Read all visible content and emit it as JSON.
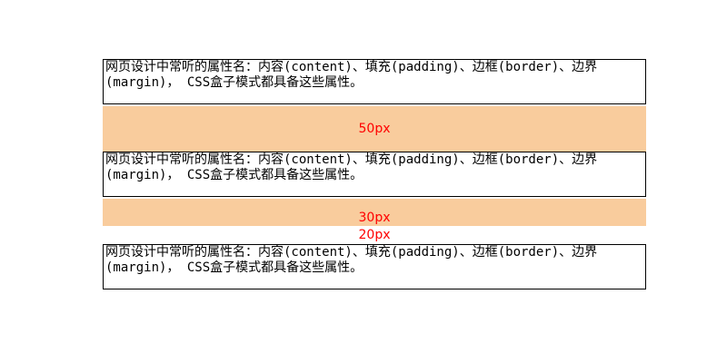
{
  "boxes": [
    {
      "line1": "网页设计中常听的属性名：内容(content)、填充(padding)、边框(border)、边界",
      "line2": "(margin)， CSS盒子模式都具备这些属性。"
    },
    {
      "line1": "网页设计中常听的属性名：内容(content)、填充(padding)、边框(border)、边界",
      "line2": "(margin)， CSS盒子模式都具备这些属性。"
    },
    {
      "line1": "网页设计中常听的属性名：内容(content)、填充(padding)、边框(border)、边界",
      "line2": "(margin)， CSS盒子模式都具备这些属性。"
    }
  ],
  "margins": {
    "first": "50px",
    "second": "30px",
    "third": "20px"
  },
  "colors": {
    "margin_fill": "#f9cc9d",
    "margin_label": "#ff0000",
    "box_border": "#000000"
  }
}
